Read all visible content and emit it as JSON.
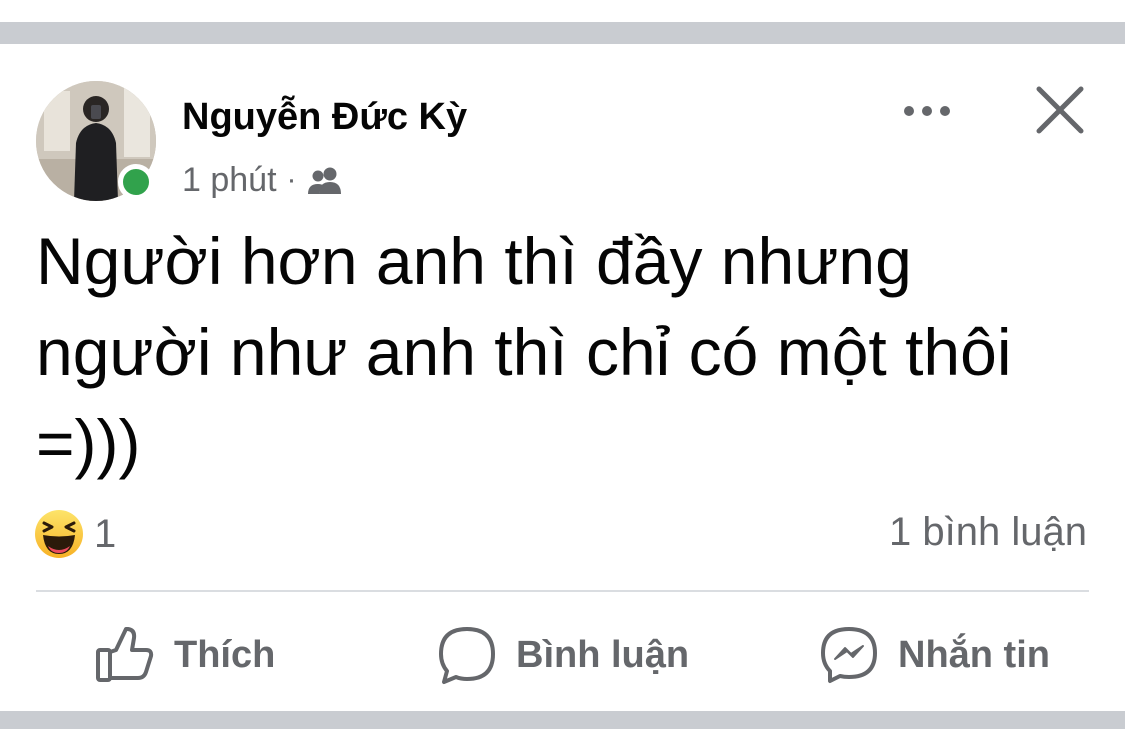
{
  "post": {
    "author": {
      "name": "Nguyễn Đức Kỳ",
      "avatar_icon": "profile-photo",
      "online": true,
      "online_color": "#31a24c"
    },
    "meta": {
      "time": "1 phút",
      "separator": "·",
      "audience_icon": "friends-icon"
    },
    "header_actions": {
      "more_icon": "more-horizontal-icon",
      "close_icon": "close-icon"
    },
    "text_lines": [
      "Người hơn anh thì đầy nhưng",
      "người như anh thì chỉ có một thôi",
      "=)))"
    ],
    "reactions": {
      "icon": "haha-icon",
      "count": "1"
    },
    "comments_count": "1 bình luận",
    "actions": [
      {
        "label": "Thích",
        "icon": "thumbs-up-icon"
      },
      {
        "label": "Bình luận",
        "icon": "comment-icon"
      },
      {
        "label": "Nhắn tin",
        "icon": "messenger-icon"
      }
    ]
  },
  "colors": {
    "text_primary": "#050505",
    "text_secondary": "#65676b",
    "separator_band": "#c9ccd1",
    "divider": "#dadde1"
  }
}
